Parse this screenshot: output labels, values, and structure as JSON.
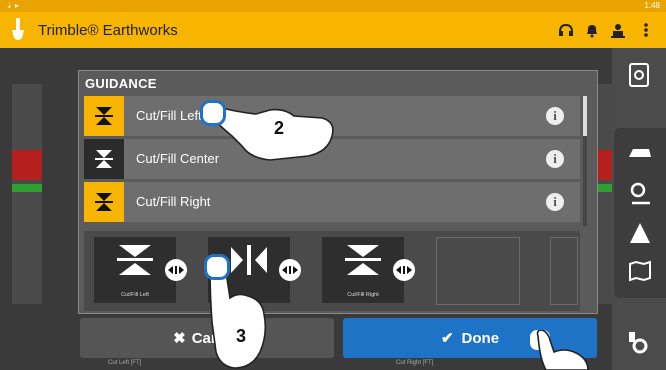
{
  "status": {
    "left": "⇣ ▸",
    "time": "1:48"
  },
  "app": {
    "title": "Trimble® Earthworks"
  },
  "guidance": {
    "title": "GUIDANCE",
    "options": [
      {
        "label": "Cut/Fill Left",
        "selected": true
      },
      {
        "label": "Cut/Fill Center",
        "selected": false
      },
      {
        "label": "Cut/Fill Right",
        "selected": true
      }
    ],
    "tiles": [
      "Cut/Fill Left",
      "",
      "Cut/Fill Right"
    ]
  },
  "buttons": {
    "cancel": "Cancel",
    "done": "Done"
  },
  "footer": {
    "left": "Cut Left [FT]",
    "right": "Cut Right [FT]"
  },
  "callouts": {
    "step2": "2",
    "step3": "3"
  },
  "colors": {
    "accent": "#f7b500",
    "done": "#1f73c7",
    "alert": "#b3201d",
    "ok": "#2fa02f"
  }
}
